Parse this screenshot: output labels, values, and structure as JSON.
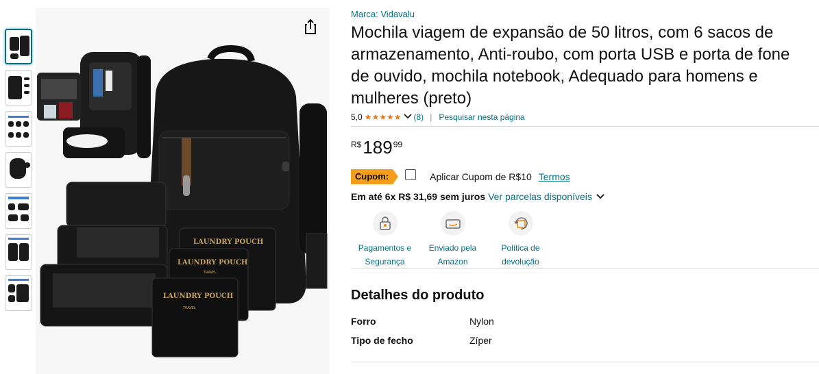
{
  "brand": {
    "text": "Marca: Vidavalu"
  },
  "product": {
    "title": "Mochila viagem de expansão de 50 litros, com 6 sacos de armazenamento, Anti-roubo, com porta USB e porta de fone de ouvido, mochila notebook, Adequado para homens e mulheres (preto)"
  },
  "rating": {
    "value": "5,0",
    "stars": 5,
    "count": "(8)",
    "search_link": "Pesquisar nesta página"
  },
  "price": {
    "currency": "R$",
    "whole": "189",
    "fraction": "99"
  },
  "coupon": {
    "badge": "Cupom:",
    "apply_label": "Aplicar Cupom de R$10",
    "terms": "Termos",
    "checked": false
  },
  "installments": {
    "text": "Em até 6x R$ 31,69 sem juros",
    "link": "Ver parcelas disponíveis"
  },
  "features": [
    {
      "line1": "Pagamentos e",
      "line2": "Segurança",
      "icon": "payment-security-icon"
    },
    {
      "line1": "Enviado pela",
      "line2": "Amazon",
      "icon": "delivery-truck-icon"
    },
    {
      "line1": "Política de",
      "line2": "devolução",
      "icon": "return-policy-icon"
    }
  ],
  "details": {
    "title": "Detalhes do produto",
    "rows": [
      {
        "key": "Forro",
        "value": "Nylon"
      },
      {
        "key": "Tipo de fecho",
        "value": "Zíper"
      }
    ]
  },
  "colors": {
    "link": "#007185",
    "star": "#de7921",
    "coupon": "#f49e1d",
    "active_thumb": "#007185"
  },
  "image_overlay": {
    "pouch_label": "LAUNDRY POUCH",
    "pouch_sub": "TRAVEL"
  }
}
